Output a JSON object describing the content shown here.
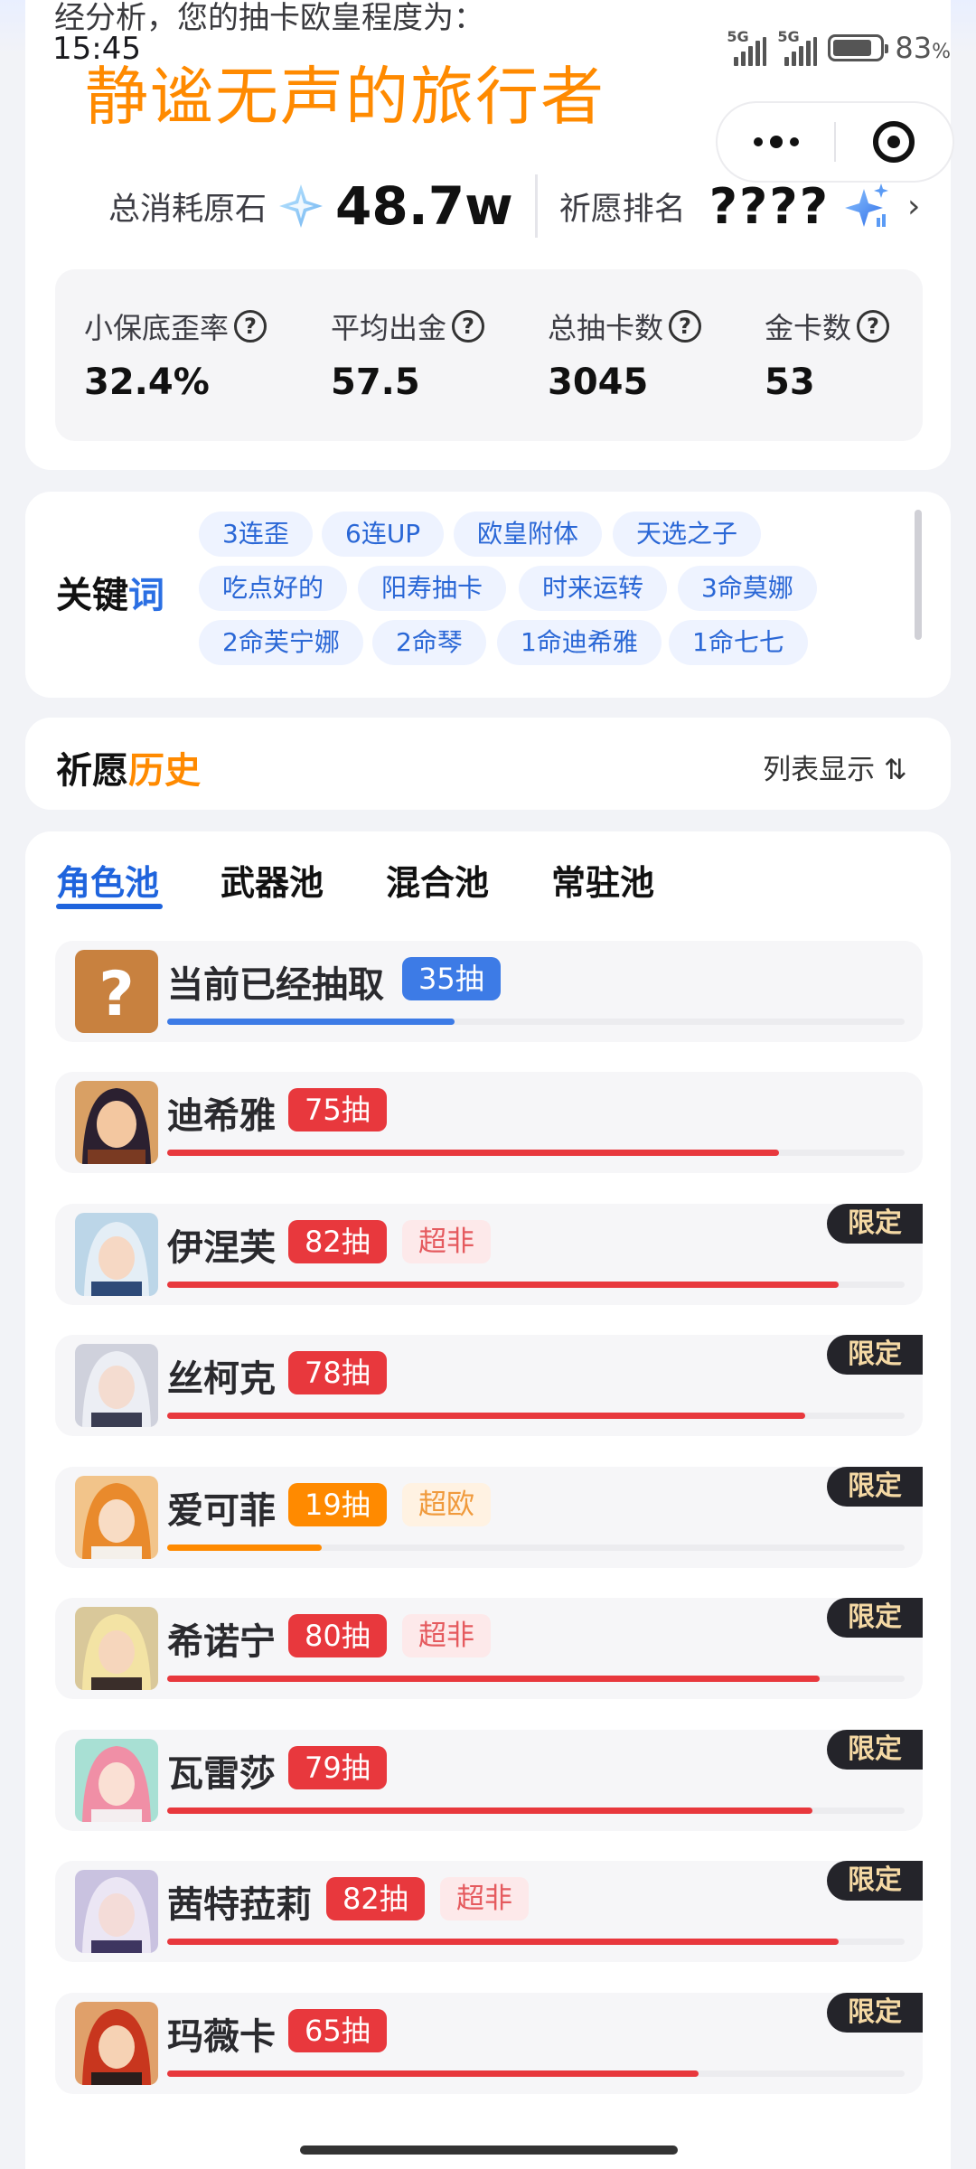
{
  "status_bar": {
    "time": "15:45",
    "signal_1": "5G",
    "signal_2": "5G",
    "battery": "83",
    "battery_unit": "%"
  },
  "header": {
    "cut_text": "经分析，您的抽卡欧皇程度为：",
    "title": "静谧无声的旅行者"
  },
  "summary": {
    "total_label": "总消耗原石",
    "total_value": "48.7w",
    "rank_label": "祈愿排名",
    "rank_value": "????"
  },
  "stats": [
    {
      "label": "小保底歪率",
      "value": "32.4%"
    },
    {
      "label": "平均出金",
      "value": "57.5"
    },
    {
      "label": "总抽卡数",
      "value": "3045"
    },
    {
      "label": "金卡数",
      "value": "53"
    }
  ],
  "keywords": {
    "title_a": "关键",
    "title_b": "词",
    "tags": [
      "3连歪",
      "6连UP",
      "欧皇附体",
      "天选之子",
      "吃点好的",
      "阳寿抽卡",
      "时来运转",
      "3命莫娜",
      "2命芙宁娜",
      "2命琴",
      "1命迪希雅",
      "1命七七"
    ]
  },
  "history": {
    "title_a": "祈愿",
    "title_b": "历史",
    "toggle": "列表显示 ⇅"
  },
  "tabs": [
    "角色池",
    "武器池",
    "混合池",
    "常驻池"
  ],
  "limited_label": "限定",
  "rows": [
    {
      "name": "当前已经抽取",
      "pulls": "35抽",
      "progress": 0.39,
      "color": "#3d7be6",
      "note": "",
      "limited": false
    },
    {
      "name": "迪希雅",
      "pulls": "75抽",
      "progress": 0.83,
      "color": "#e8383d",
      "note": "",
      "limited": false
    },
    {
      "name": "伊涅芙",
      "pulls": "82抽",
      "progress": 0.91,
      "color": "#e8383d",
      "note": "超非",
      "limited": true
    },
    {
      "name": "丝柯克",
      "pulls": "78抽",
      "progress": 0.865,
      "color": "#e8383d",
      "note": "",
      "limited": true
    },
    {
      "name": "爱可菲",
      "pulls": "19抽",
      "progress": 0.21,
      "color": "#ff8a00",
      "note": "超欧",
      "limited": true
    },
    {
      "name": "希诺宁",
      "pulls": "80抽",
      "progress": 0.885,
      "color": "#e8383d",
      "note": "超非",
      "limited": true
    },
    {
      "name": "瓦雷莎",
      "pulls": "79抽",
      "progress": 0.875,
      "color": "#e8383d",
      "note": "",
      "limited": true
    },
    {
      "name": "茜特菈莉",
      "pulls": "82抽",
      "progress": 0.91,
      "color": "#e8383d",
      "note": "超非",
      "limited": true
    },
    {
      "name": "玛薇卡",
      "pulls": "65抽",
      "progress": 0.72,
      "color": "#e8383d",
      "note": "",
      "limited": true
    }
  ]
}
